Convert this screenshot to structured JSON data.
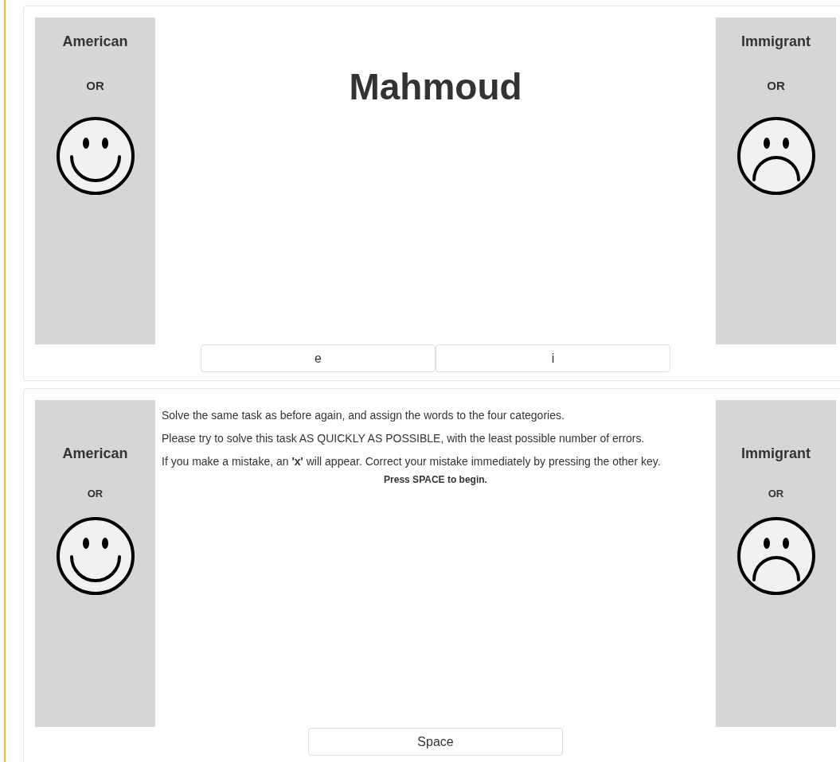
{
  "panels": [
    {
      "left": {
        "label": "American",
        "or": "OR",
        "kind": "smile"
      },
      "right": {
        "label": "Immigrant",
        "or": "OR",
        "kind": "frown"
      },
      "stimulus": "Mahmoud",
      "keys": [
        "e",
        "i"
      ]
    },
    {
      "left": {
        "label": "American",
        "or": "OR",
        "kind": "smile"
      },
      "right": {
        "label": "Immigrant",
        "or": "OR",
        "kind": "frown"
      },
      "instructions": [
        "Solve the same task as before again, and assign the words to the four categories.",
        "Please try to solve this task AS QUICKLY AS POSSIBLE, with the least possible number of errors.",
        "If you make a mistake, an **'x'** will appear. Correct your mistake immediately by pressing the other key."
      ],
      "prompt": "Press SPACE to begin.",
      "keys": [
        "Space"
      ]
    }
  ]
}
